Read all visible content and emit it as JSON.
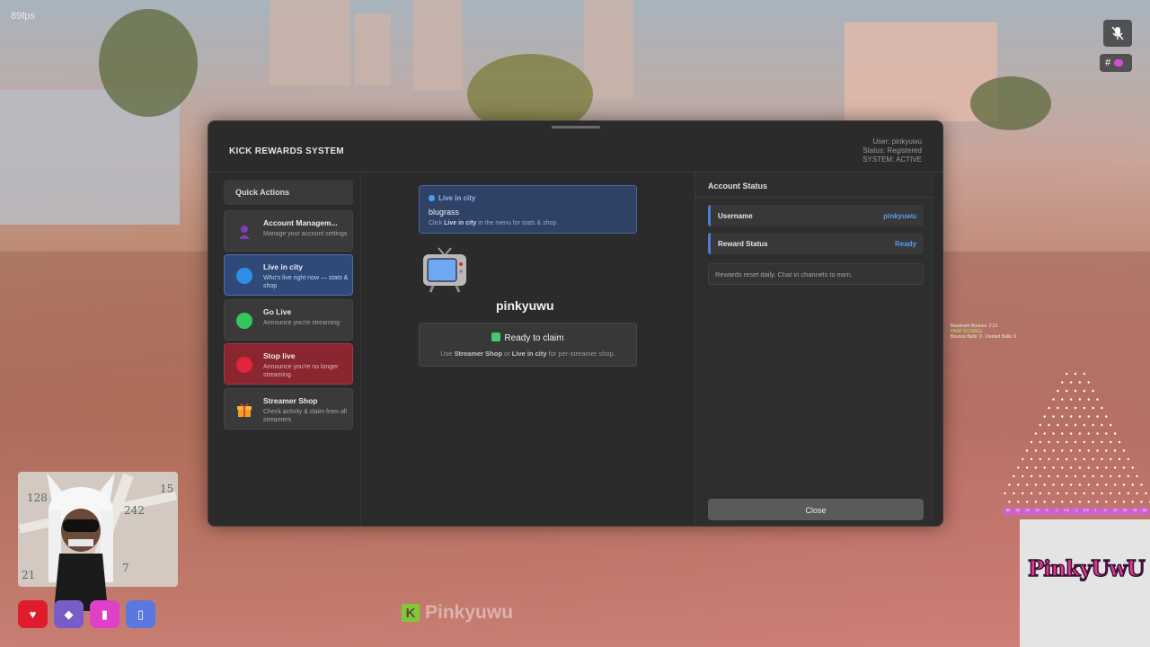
{
  "hud": {
    "fps": "89fps",
    "mic_icon": "mic-muted-icon",
    "hash_label": "#",
    "watermark": "Pinkyuwu"
  },
  "panel": {
    "title": "KICK REWARDS SYSTEM",
    "user_line": "User: pinkyuwu",
    "status_line": "Status: Registered",
    "system_line": "SYSTEM: ACTIVE"
  },
  "quick_actions": {
    "heading": "Quick Actions",
    "items": [
      {
        "title": "Account Managem...",
        "subtitle": "Manage your account settings",
        "icon": "person-icon",
        "color": "#7b3fb0"
      },
      {
        "title": "Live in city",
        "subtitle": "Who's live right now — stats & shop",
        "icon": "blue-circle-icon",
        "color": "#2f8fe8"
      },
      {
        "title": "Go Live",
        "subtitle": "Announce you're streaming",
        "icon": "green-circle-icon",
        "color": "#34c759"
      },
      {
        "title": "Stop live",
        "subtitle": "Announce you're no longer streaming",
        "icon": "red-circle-icon",
        "color": "#e0263a"
      },
      {
        "title": "Streamer Shop",
        "subtitle": "Check activity & claim from all streamers",
        "icon": "gift-icon",
        "color": "#f0a020"
      }
    ]
  },
  "center": {
    "live_label": "Live in city",
    "live_name": "blugrass",
    "live_hint_pre": "Click ",
    "live_hint_bold": "Live in city",
    "live_hint_post": " in the menu for stats & shop.",
    "streamer_name": "pinkyuwu",
    "claim_title": "Ready to claim",
    "claim_hint_pre": "Use ",
    "claim_hint_bold1": "Streamer Shop",
    "claim_hint_mid": " or ",
    "claim_hint_bold2": "Live in city",
    "claim_hint_post": " for per-streamer shop."
  },
  "account_status": {
    "heading": "Account Status",
    "rows": [
      {
        "key": "Username",
        "value": "pinkyuwu"
      },
      {
        "key": "Reward Status",
        "value": "Ready"
      }
    ],
    "note": "Rewards reset daily. Chat in channels to earn.",
    "close_label": "Close"
  },
  "minimap": {
    "numbers": [
      "128",
      "15",
      "242",
      "21",
      "7"
    ]
  },
  "stats_overlay": {
    "line1": "Maximum Bounce: 2.21",
    "line2": "HIGH SCORES",
    "line3": "Bounce Balls: 0 · Dented Balls: 0"
  },
  "plinko_slots": [
    "50",
    "25",
    "20",
    "10",
    "5",
    "1",
    "0.5",
    "-1",
    "0.5",
    "1",
    "5",
    "10",
    "20",
    "25",
    "50"
  ],
  "logo_text": "PinkyUwU"
}
